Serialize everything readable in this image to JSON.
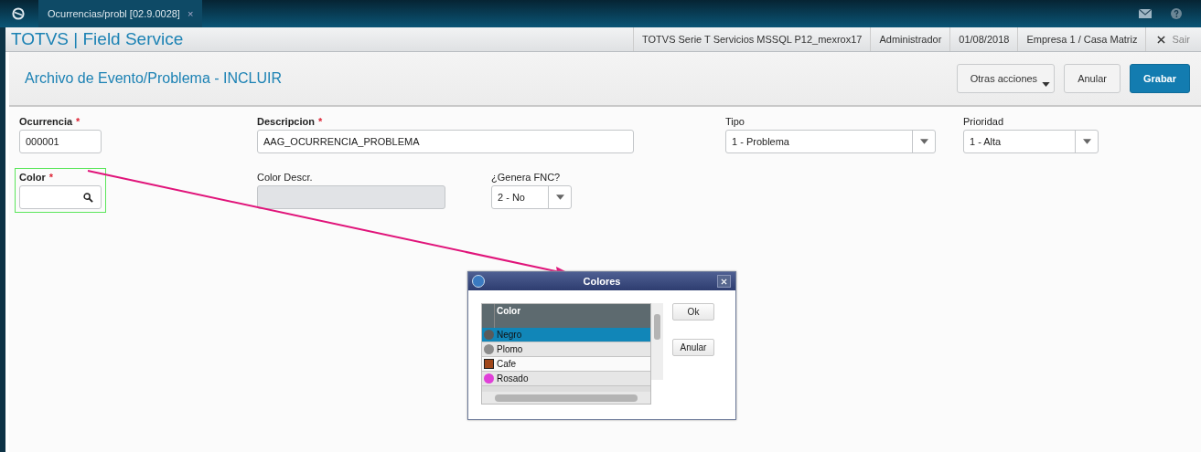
{
  "tab": {
    "label": "Ocurrencias/probl [02.9.0028]",
    "close": "×"
  },
  "header": {
    "brand": "TOTVS | Field Service",
    "info": [
      "TOTVS Serie T Servicios MSSQL P12_mexrox17",
      "Administrador",
      "01/08/2018",
      "Empresa 1 / Casa Matriz"
    ],
    "logout": "Sair"
  },
  "page": {
    "title": "Archivo de Evento/Problema - INCLUIR",
    "buttons": [
      {
        "label": "Otras acciones",
        "kind": "menu"
      },
      {
        "label": "Anular",
        "kind": "plain"
      },
      {
        "label": "Grabar",
        "kind": "primary"
      }
    ]
  },
  "fields": [
    {
      "label": "Ocurrencia",
      "mark": "*",
      "kind": "text",
      "value": "000001",
      "highlighted": false
    },
    {
      "label": "Descripcion",
      "mark": "*",
      "kind": "text",
      "value": "AAG_OCURRENCIA_PROBLEMA",
      "highlighted": false
    },
    {
      "label": "Tipo",
      "kind": "select",
      "value": "1 - Problema",
      "highlighted": false
    },
    {
      "label": "Prioridad",
      "kind": "select",
      "value": "1 - Alta",
      "highlighted": false
    },
    {
      "label": "Color",
      "mark": "*",
      "kind": "lookup",
      "highlighted": true
    },
    {
      "label": "Color Descr.",
      "kind": "readonly",
      "highlighted": false
    },
    {
      "label": "¿Genera FNC?",
      "kind": "select",
      "value": "2 - No",
      "highlighted": false
    }
  ],
  "dialog": {
    "title": "Colores",
    "column": "Color",
    "rows": [
      {
        "name": "Negro",
        "color": "#5a5a5a",
        "selected": true
      },
      {
        "name": "Plomo",
        "color": "#8c8c8c",
        "selected": false
      },
      {
        "name": "Cafe",
        "color": "#a0471a",
        "selected": false
      },
      {
        "name": "Rosado",
        "color": "#e040d8",
        "selected": false
      }
    ],
    "buttons": [
      "Ok",
      "Anular"
    ]
  }
}
